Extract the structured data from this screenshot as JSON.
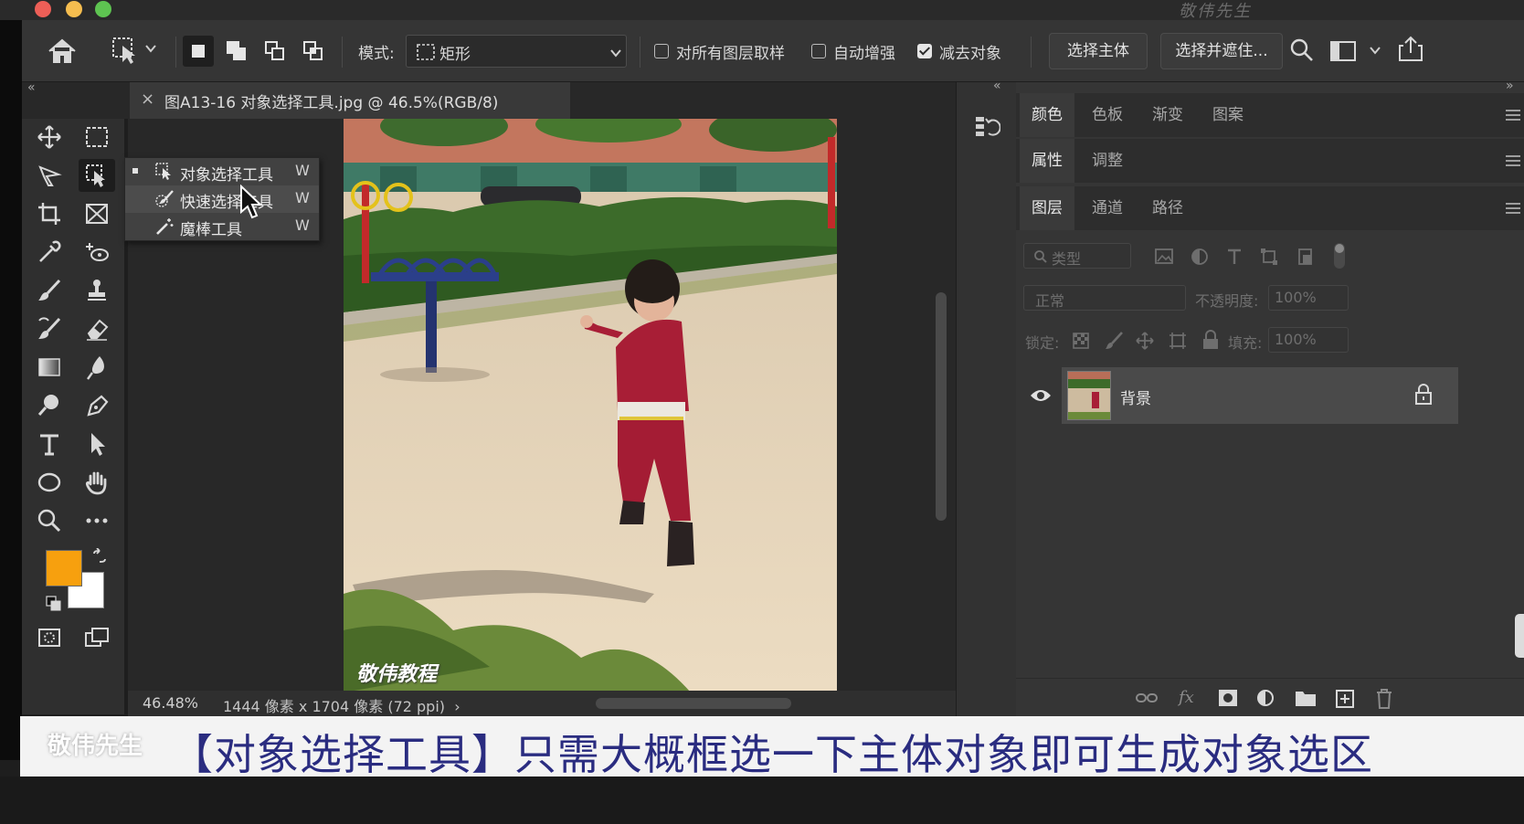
{
  "window": {
    "watermark": "敬伟先生"
  },
  "options_bar": {
    "mode_label": "模式:",
    "mode_value": "矩形",
    "sample_all_layers": "对所有图层取样",
    "sample_all_layers_checked": false,
    "auto_enhance": "自动增强",
    "auto_enhance_checked": false,
    "subtract_object": "减去对象",
    "subtract_object_checked": true,
    "select_subject_button": "选择主体",
    "select_and_mask_button": "选择并遮住..."
  },
  "document": {
    "tab_title": "图A13-16 对象选择工具.jpg @ 46.5%(RGB/8)",
    "close_glyph": "×",
    "zoom": "46.48%",
    "size": "1444 像素 x 1704 像素 (72 ppi)",
    "status_arrow": "›",
    "photo_watermark": "敬伟教程"
  },
  "tool_flyout": {
    "items": [
      {
        "label": "对象选择工具",
        "key": "W",
        "selected": true
      },
      {
        "label": "快速选择工具",
        "key": "W",
        "selected": false
      },
      {
        "label": "魔棒工具",
        "key": "W",
        "selected": false
      }
    ]
  },
  "colors": {
    "foreground": "#f7a00e",
    "background": "#ffffff",
    "ui_dark": "#353535"
  },
  "panels": {
    "row1_tabs": [
      "颜色",
      "色板",
      "渐变",
      "图案"
    ],
    "row2_tabs": [
      "属性",
      "调整"
    ],
    "row3_tabs": [
      "图层",
      "通道",
      "路径"
    ],
    "filter_kind": "类型",
    "blend_mode": "正常",
    "opacity_label": "不透明度:",
    "opacity_value": "100%",
    "lock_label": "锁定:",
    "fill_label": "填充:",
    "fill_value": "100%",
    "collapse_glyph": "«",
    "expand_glyph": "»"
  },
  "layers": [
    {
      "name": "背景",
      "visible": true,
      "locked": true
    }
  ],
  "subtitle": {
    "text": "【对象选择工具】只需大概框选一下主体对象即可生成对象选区",
    "watermark": "敬伟先生"
  }
}
